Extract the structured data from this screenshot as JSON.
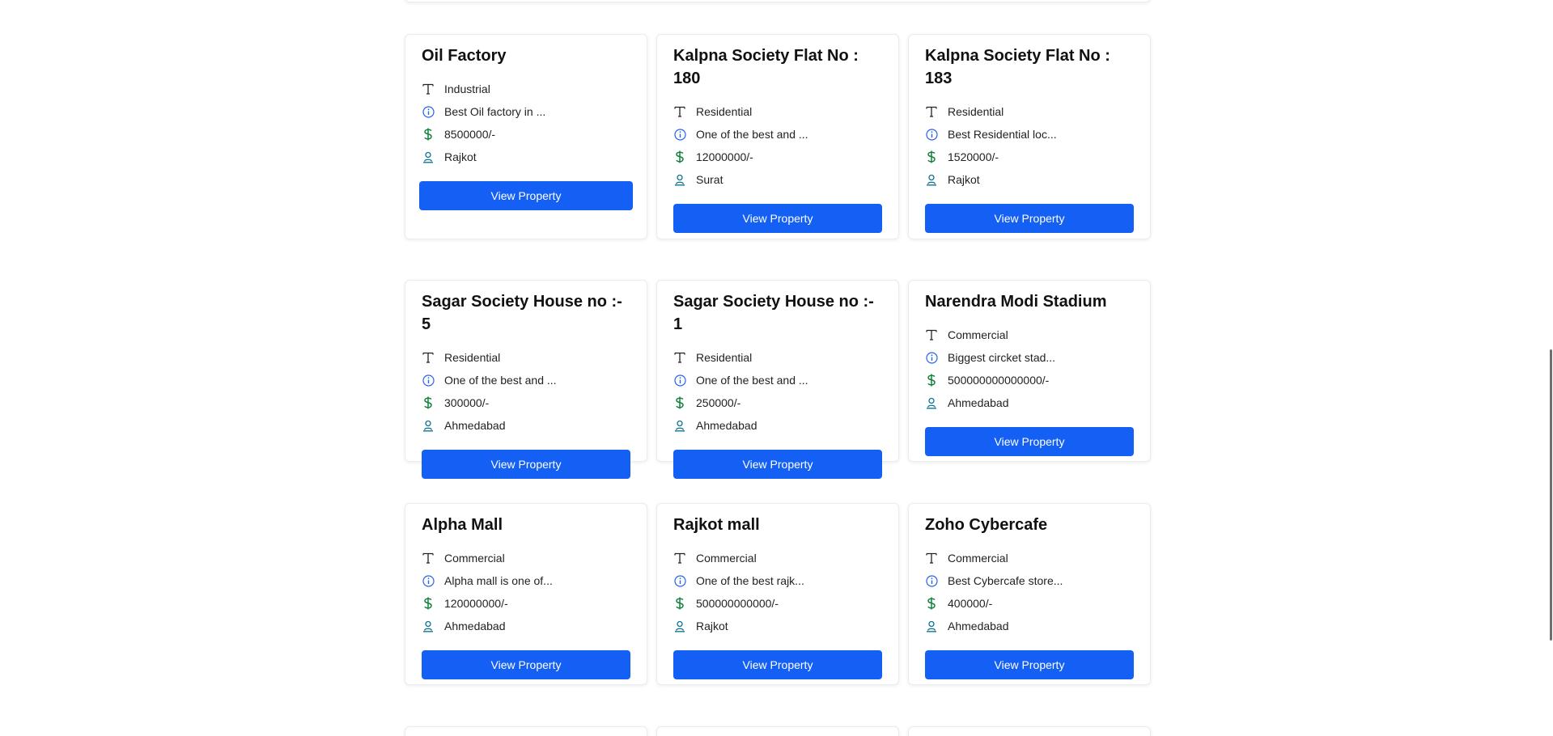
{
  "colors": {
    "accent": "#1460f5",
    "info_icon": "#2563eb",
    "price_icon": "#15803d",
    "location_icon": "#0e7490"
  },
  "button_label": "View Property",
  "properties": [
    {
      "title": "Oil Factory",
      "type": "Industrial",
      "description": "Best Oil factory in ...",
      "price": "8500000/-",
      "location": "Rajkot"
    },
    {
      "title": "Kalpna Society Flat No : 180",
      "type": "Residential",
      "description": "One of the best and ...",
      "price": "12000000/-",
      "location": "Surat"
    },
    {
      "title": "Kalpna Society Flat No : 183",
      "type": "Residential",
      "description": "Best Residential loc...",
      "price": "1520000/-",
      "location": "Rajkot"
    },
    {
      "title": "Sagar Society House no :- 5",
      "type": "Residential",
      "description": "One of the best and ...",
      "price": "300000/-",
      "location": "Ahmedabad"
    },
    {
      "title": "Sagar Society House no :- 1",
      "type": "Residential",
      "description": "One of the best and ...",
      "price": "250000/-",
      "location": "Ahmedabad"
    },
    {
      "title": "Narendra Modi Stadium",
      "type": "Commercial",
      "description": "Biggest circket stad...",
      "price": "500000000000000/-",
      "location": "Ahmedabad"
    },
    {
      "title": "Alpha Mall",
      "type": "Commercial",
      "description": "Alpha mall is one of...",
      "price": "120000000/-",
      "location": "Ahmedabad"
    },
    {
      "title": "Rajkot mall",
      "type": "Commercial",
      "description": "One of the best rajk...",
      "price": "500000000000/-",
      "location": "Rajkot"
    },
    {
      "title": "Zoho Cybercafe",
      "type": "Commercial",
      "description": "Best Cybercafe store...",
      "price": "400000/-",
      "location": "Ahmedabad"
    }
  ]
}
